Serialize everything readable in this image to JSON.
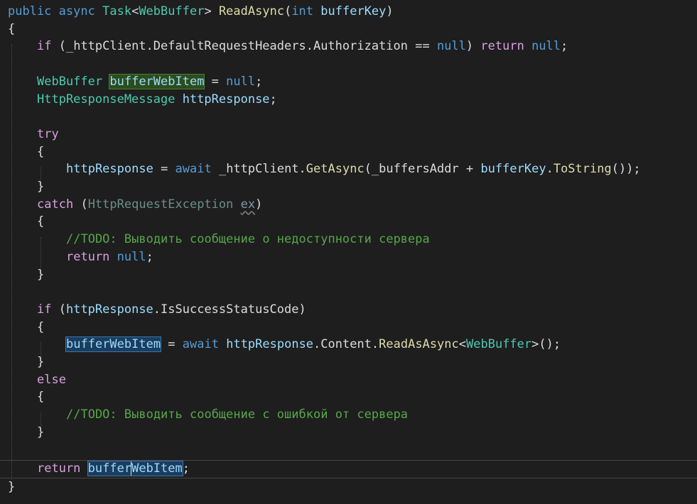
{
  "colors": {
    "background": "#1e1e1e",
    "keyword": "#569cd6",
    "control_keyword": "#d8a0df",
    "type": "#4ec9b0",
    "method": "#dcdcaa",
    "variable": "#9cdcfe",
    "comment": "#57a64a",
    "plain": "#dcdcdc"
  },
  "code": {
    "sig_public": "public",
    "sig_async": "async",
    "sig_task": "Task",
    "lt": "<",
    "gt": ">",
    "t_webbuffer": "WebBuffer",
    "m_readasync": "ReadAsync",
    "lparen": "(",
    "kw_int": "int",
    "v_bufferkey": "bufferKey",
    "rparen": ")",
    "open_brace": "{",
    "close_brace": "}",
    "kw_if": "if",
    "paren_space": " (",
    "l2_expr": "_httpClient.DefaultRequestHeaders.Authorization == ",
    "kw_null": "null",
    "kw_return": "return",
    "semicolon": ";",
    "v_bufferwebitem": "bufferWebItem",
    "v_bufferwebitem_a": "buffer",
    "v_bufferwebitem_b": "WebItem",
    "assign": " = ",
    "t_httpresponsemessage": "HttpResponseMessage",
    "v_httpresponse": "httpResponse",
    "kw_try": "try",
    "kw_await": "await",
    "l8_client": " _httpClient.",
    "m_getasync": "GetAsync",
    "l8_addr": "(_buffersAddr + ",
    "dot": ".",
    "m_tostring": "ToString",
    "l8_end": "());",
    "kw_catch": "catch",
    "t_httprequestexception": "HttpRequestException",
    "v_ex": "ex",
    "comment_todo_unavailable": "//TODO: Выводить сообщение о недоступности сервера",
    "p_issuccess": ".IsSuccessStatusCode)",
    "l19_content": ".Content.",
    "m_readasasync": "ReadAsAsync",
    "l19_end": "();",
    "kw_else": "else",
    "comment_todo_error": "//TODO: Выводить сообщение с ошибкой от сервера"
  }
}
